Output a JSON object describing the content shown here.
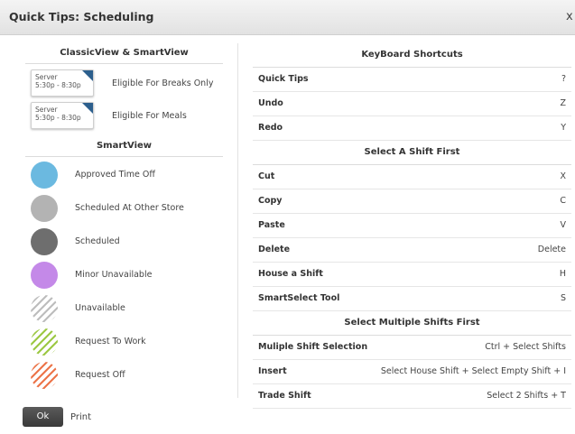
{
  "dialog": {
    "title": "Quick Tips: Scheduling",
    "close": "x"
  },
  "left": {
    "classic_heading": "ClassicView & SmartView",
    "shift_cards": [
      {
        "role": "Server",
        "time": "5:30p - 8:30p",
        "label": "Eligible For Breaks Only"
      },
      {
        "role": "Server",
        "time": "5:30p - 8:30p",
        "label": "Eligible For Meals"
      }
    ],
    "smart_heading": "SmartView",
    "legend": [
      {
        "label": "Approved Time Off",
        "style": "solid",
        "color": "#6bb9e0"
      },
      {
        "label": "Scheduled At Other Store",
        "style": "solid",
        "color": "#b3b3b3"
      },
      {
        "label": "Scheduled",
        "style": "solid",
        "color": "#6e6e6e"
      },
      {
        "label": "Minor Unavailable",
        "style": "solid",
        "color": "#c489e8"
      },
      {
        "label": "Unavailable",
        "style": "striped",
        "color": "#bdbdbd"
      },
      {
        "label": "Request To Work",
        "style": "striped",
        "color": "#9cc843"
      },
      {
        "label": "Request Off",
        "style": "striped",
        "color": "#ec7449"
      }
    ]
  },
  "right": {
    "sections": [
      {
        "heading": "KeyBoard Shortcuts",
        "rows": [
          {
            "name": "Quick Tips",
            "key": "?"
          },
          {
            "name": "Undo",
            "key": "Z"
          },
          {
            "name": "Redo",
            "key": "Y"
          }
        ]
      },
      {
        "heading": "Select A Shift First",
        "rows": [
          {
            "name": "Cut",
            "key": "X"
          },
          {
            "name": "Copy",
            "key": "C"
          },
          {
            "name": "Paste",
            "key": "V"
          },
          {
            "name": "Delete",
            "key": "Delete"
          },
          {
            "name": "House a Shift",
            "key": "H"
          },
          {
            "name": "SmartSelect Tool",
            "key": "S"
          }
        ]
      },
      {
        "heading": "Select Multiple Shifts First",
        "rows": [
          {
            "name": "Muliple Shift Selection",
            "key": "Ctrl + Select Shifts"
          },
          {
            "name": "Insert",
            "key": "Select House Shift + Select Empty Shift + I"
          },
          {
            "name": "Trade Shift",
            "key": "Select 2 Shifts + T"
          }
        ]
      }
    ]
  },
  "footer": {
    "ok": "Ok",
    "print": "Print"
  }
}
